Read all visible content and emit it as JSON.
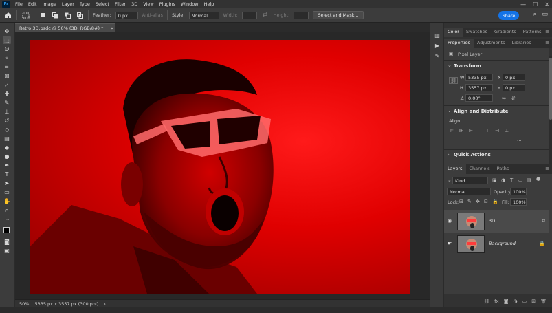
{
  "menubar": {
    "logo": "Ps",
    "items": [
      "File",
      "Edit",
      "Image",
      "Layer",
      "Type",
      "Select",
      "Filter",
      "3D",
      "View",
      "Plugins",
      "Window",
      "Help"
    ],
    "window_controls": [
      "—",
      "☐",
      "✕"
    ]
  },
  "options": {
    "feather_label": "Feather:",
    "feather_value": "0 px",
    "antialias_label": "Anti-alias",
    "style_label": "Style:",
    "style_value": "Normal",
    "width_label": "Width:",
    "height_label": "Height:",
    "select_mask_label": "Select and Mask...",
    "share_label": "Share"
  },
  "document": {
    "tab_title": "Retro 3D.psdc @ 50% (3D, RGB/8#) *",
    "tab_close": "×"
  },
  "status": {
    "zoom": "50%",
    "doc_info": "5335 px x 3557 px (300 ppi)",
    "arrow": "›"
  },
  "panels": {
    "top_tabs": [
      "Color",
      "Swatches",
      "Gradients",
      "Patterns"
    ],
    "prop_tabs": [
      "Properties",
      "Adjustments",
      "Libraries"
    ],
    "pixel_layer_label": "Pixel Layer",
    "transform_title": "Transform",
    "w_label": "W",
    "w_value": "5335 px",
    "h_label": "H",
    "h_value": "3557 px",
    "x_label": "X",
    "x_value": "0 px",
    "y_label": "Y",
    "y_value": "0 px",
    "angle_value": "0.00°",
    "align_title": "Align and Distribute",
    "align_label": "Align:",
    "more": "···",
    "quick_actions_title": "Quick Actions",
    "layer_tabs": [
      "Layers",
      "Channels",
      "Paths"
    ],
    "kind_label": "Kind",
    "blend_mode": "Normal",
    "opacity_label": "Opacity:",
    "opacity_value": "100%",
    "lock_label": "Lock:",
    "fill_label": "Fill:",
    "fill_value": "100%",
    "layers": [
      {
        "name": "3D",
        "italic": false
      },
      {
        "name": "Background",
        "italic": true
      }
    ]
  },
  "colors": {
    "accent": "#1473e6",
    "canvas_red": "#e00000",
    "panel_bg": "#323232"
  }
}
